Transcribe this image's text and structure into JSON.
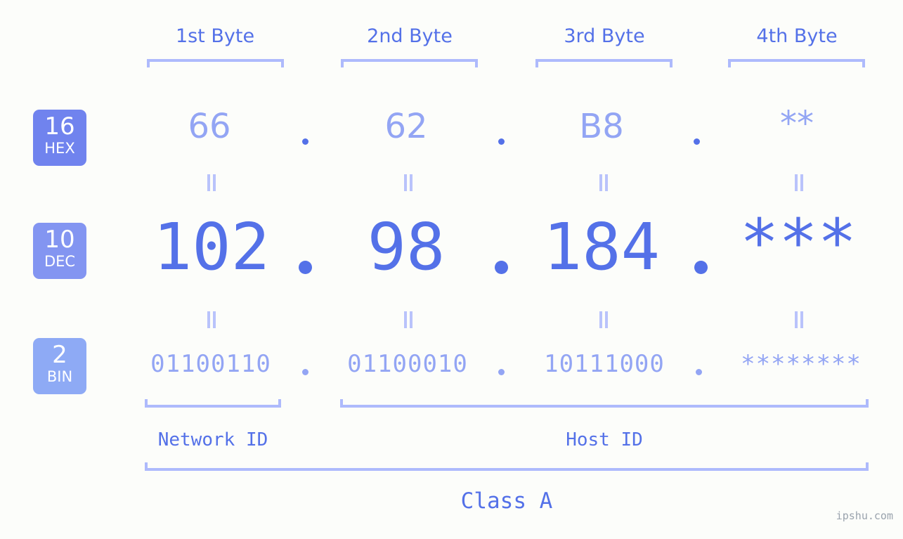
{
  "page": {
    "background_color": "#fcfdfa",
    "accent_color": "#5471e8",
    "accent_light_color": "#93a5f4",
    "bracket_color": "#aebafc",
    "watermark": "ipshu.com"
  },
  "byte_headers": [
    {
      "label": "1st Byte"
    },
    {
      "label": "2nd Byte"
    },
    {
      "label": "3rd Byte"
    },
    {
      "label": "4th Byte"
    }
  ],
  "bases": [
    {
      "number": "16",
      "name": "HEX",
      "color": "#7083ee"
    },
    {
      "number": "10",
      "name": "DEC",
      "color": "#8395f1"
    },
    {
      "number": "2",
      "name": "BIN",
      "color": "#8eaaf5"
    }
  ],
  "rows": {
    "hex": {
      "base_number": "16",
      "base_name": "HEX",
      "values": [
        "66",
        "62",
        "B8",
        "**"
      ],
      "separator": "."
    },
    "dec": {
      "base_number": "10",
      "base_name": "DEC",
      "values": [
        "102",
        "98",
        "184",
        "***"
      ],
      "separator": "."
    },
    "bin": {
      "base_number": "2",
      "base_name": "BIN",
      "values": [
        "01100110",
        "01100010",
        "10111000",
        "********"
      ],
      "separator": "."
    }
  },
  "equals_marks": {
    "symbol": "=",
    "hex_to_dec": [
      "=",
      "=",
      "=",
      "="
    ],
    "dec_to_bin": [
      "=",
      "=",
      "=",
      "="
    ]
  },
  "id_sections": [
    {
      "label": "Network ID",
      "spans_bytes": "1"
    },
    {
      "label": "Host ID",
      "spans_bytes": "2-4"
    }
  ],
  "class_section": {
    "label": "Class A",
    "spans_bytes": "1-4"
  },
  "chart_data": {
    "type": "table",
    "title": "IP address byte breakdown by numeral base",
    "columns": [
      "1st Byte",
      "2nd Byte",
      "3rd Byte",
      "4th Byte"
    ],
    "rows": [
      {
        "base": "16 HEX",
        "cells": [
          "66",
          "62",
          "B8",
          "**"
        ]
      },
      {
        "base": "10 DEC",
        "cells": [
          "102",
          "98",
          "184",
          "***"
        ]
      },
      {
        "base": "2 BIN",
        "cells": [
          "01100110",
          "01100010",
          "10111000",
          "********"
        ]
      }
    ],
    "annotations": [
      "Network ID",
      "Host ID",
      "Class A"
    ]
  }
}
